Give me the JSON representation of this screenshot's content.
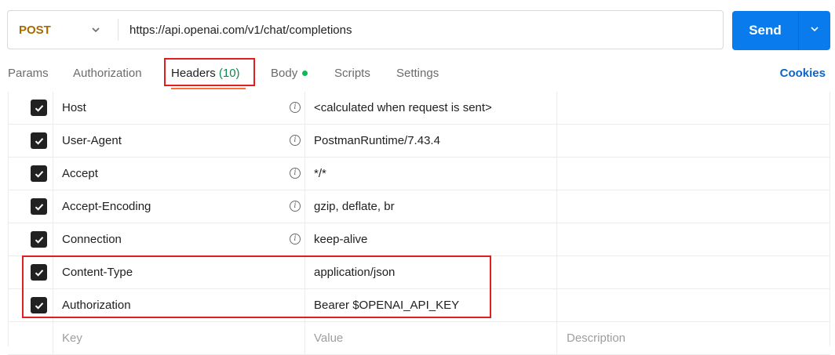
{
  "request": {
    "method": "POST",
    "url": "https://api.openai.com/v1/chat/completions",
    "send_label": "Send"
  },
  "tabs": {
    "params": "Params",
    "authorization": "Authorization",
    "headers": "Headers",
    "headers_count": "(10)",
    "body": "Body",
    "scripts": "Scripts",
    "settings": "Settings",
    "cookies": "Cookies",
    "active": "headers"
  },
  "headers": {
    "rows": [
      {
        "key": "Host",
        "value": "<calculated when request is sent>",
        "checked": true,
        "auto": true
      },
      {
        "key": "User-Agent",
        "value": "PostmanRuntime/7.43.4",
        "checked": true,
        "auto": true
      },
      {
        "key": "Accept",
        "value": "*/*",
        "checked": true,
        "auto": true
      },
      {
        "key": "Accept-Encoding",
        "value": "gzip, deflate, br",
        "checked": true,
        "auto": true
      },
      {
        "key": "Connection",
        "value": "keep-alive",
        "checked": true,
        "auto": true
      },
      {
        "key": "Content-Type",
        "value": "application/json",
        "checked": true,
        "auto": false
      },
      {
        "key": "Authorization",
        "value": "Bearer $OPENAI_API_KEY",
        "checked": true,
        "auto": false
      }
    ],
    "placeholders": {
      "key": "Key",
      "value": "Value",
      "description": "Description"
    }
  },
  "colors": {
    "method": "#a66b00",
    "send": "#097bed",
    "tab_underline": "#ff6c37",
    "highlight": "#e01e1e",
    "count": "#0b8a4c",
    "cookies": "#0d63c8"
  }
}
